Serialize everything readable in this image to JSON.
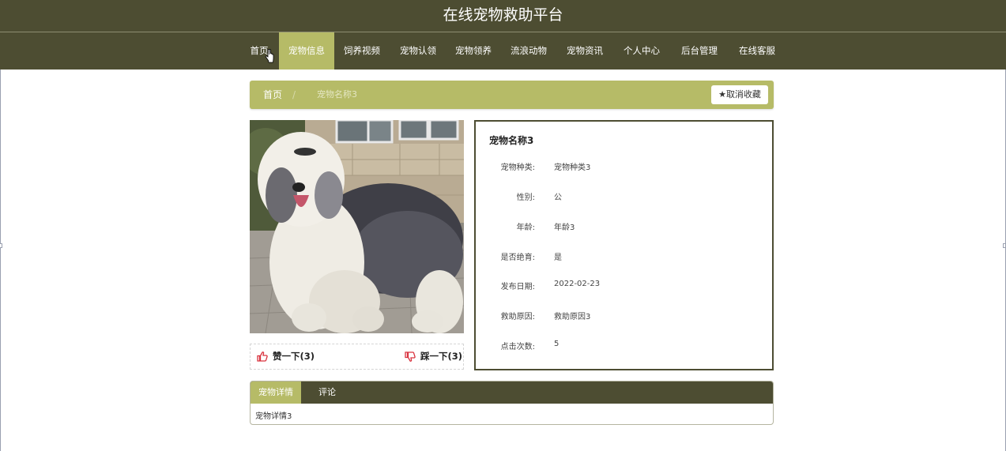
{
  "site": {
    "title": "在线宠物救助平台"
  },
  "nav": [
    {
      "label": "首页",
      "active": false
    },
    {
      "label": "宠物信息",
      "active": true
    },
    {
      "label": "饲养视频",
      "active": false
    },
    {
      "label": "宠物认领",
      "active": false
    },
    {
      "label": "宠物领养",
      "active": false
    },
    {
      "label": "流浪动物",
      "active": false
    },
    {
      "label": "宠物资讯",
      "active": false
    },
    {
      "label": "个人中心",
      "active": false
    },
    {
      "label": "后台管理",
      "active": false
    },
    {
      "label": "在线客服",
      "active": false
    }
  ],
  "breadcrumb": {
    "home": "首页",
    "separator": "/",
    "current": "宠物名称3"
  },
  "favorite_button": {
    "label": "取消收藏",
    "icon": "star-icon"
  },
  "votes": {
    "like_label": "赞一下(3)",
    "dislike_label": "踩一下(3)",
    "like_icon": "thumbs-up-icon",
    "dislike_icon": "thumbs-down-icon"
  },
  "details": {
    "name": "宠物名称3",
    "fields": [
      {
        "label": "宠物种类:",
        "value": "宠物种类3"
      },
      {
        "label": "性别:",
        "value": "公"
      },
      {
        "label": "年龄:",
        "value": "年龄3"
      },
      {
        "label": "是否绝育:",
        "value": "是"
      },
      {
        "label": "发布日期:",
        "value": "2022-02-23"
      },
      {
        "label": "救助原因:",
        "value": "救助原因3"
      },
      {
        "label": "点击次数:",
        "value": "5"
      }
    ]
  },
  "tabs": [
    {
      "label": "宠物详情",
      "active": true
    },
    {
      "label": "评论",
      "active": false
    }
  ],
  "tab_content": "宠物详情3",
  "colors": {
    "header": "#4d4d32",
    "accent": "#b6bb67",
    "vote_icon": "#d9333f"
  }
}
